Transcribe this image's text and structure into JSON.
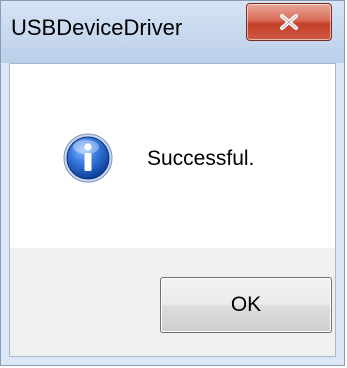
{
  "window": {
    "title": "USBDeviceDriver",
    "close_icon": "close-icon"
  },
  "message": {
    "icon": "info-icon",
    "text": "Successful."
  },
  "buttons": {
    "ok_label": "OK"
  },
  "colors": {
    "close_button": "#c94b37",
    "info_icon": "#1f5fbf"
  }
}
